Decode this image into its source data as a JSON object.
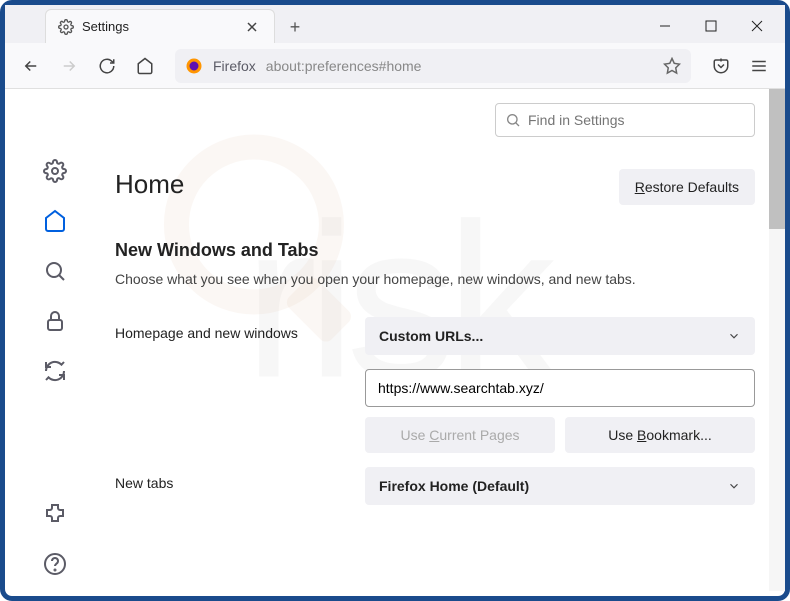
{
  "tab": {
    "title": "Settings"
  },
  "urlbar": {
    "prefix": "Firefox",
    "url": "about:preferences#home"
  },
  "search": {
    "placeholder": "Find in Settings"
  },
  "page": {
    "title": "Home",
    "restore": "Restore Defaults",
    "section_heading": "New Windows and Tabs",
    "section_desc": "Choose what you see when you open your homepage, new windows, and new tabs."
  },
  "homepage": {
    "label": "Homepage and new windows",
    "dropdown": "Custom URLs...",
    "url_value": "https://www.searchtab.xyz/",
    "use_current": "Use Current Pages",
    "use_bookmark": "Use Bookmark..."
  },
  "newtabs": {
    "label": "New tabs",
    "dropdown": "Firefox Home (Default)"
  }
}
